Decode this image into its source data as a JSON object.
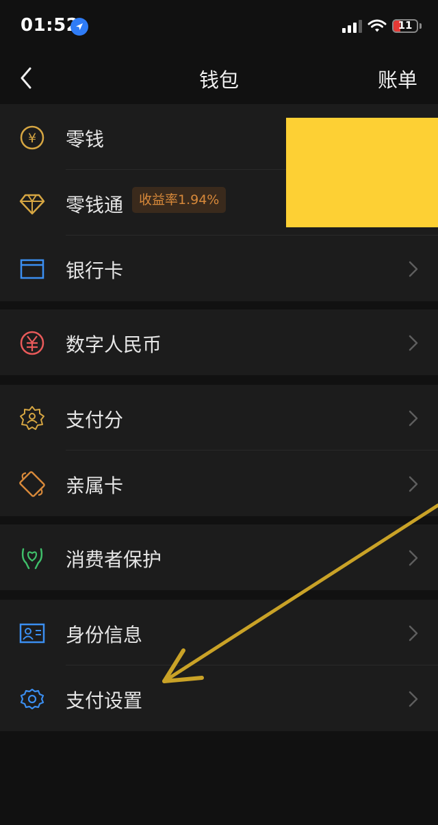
{
  "status_bar": {
    "time": "01:52",
    "battery": "11",
    "icons": [
      "location-arrow-icon",
      "cellular-signal-icon",
      "wifi-icon",
      "battery-icon"
    ]
  },
  "nav": {
    "title": "钱包",
    "right_label": "账单",
    "back_icon": "chevron-left-icon"
  },
  "groups": [
    {
      "items": [
        {
          "label": "零钱",
          "icon": "yuan-coin-icon",
          "color": "#d6a642"
        },
        {
          "label": "零钱通",
          "icon": "diamond-icon",
          "color": "#d6a642",
          "badge": "收益率1.94%"
        },
        {
          "label": "银行卡",
          "icon": "bank-card-icon",
          "color": "#3b8ff2"
        }
      ]
    },
    {
      "items": [
        {
          "label": "数字人民币",
          "icon": "digital-rmb-icon",
          "color": "#e95a5a"
        }
      ]
    },
    {
      "items": [
        {
          "label": "支付分",
          "icon": "pay-score-icon",
          "color": "#d6a642"
        },
        {
          "label": "亲属卡",
          "icon": "family-card-icon",
          "color": "#d8893a"
        }
      ]
    },
    {
      "items": [
        {
          "label": "消费者保护",
          "icon": "consumer-protection-icon",
          "color": "#3fbf6a"
        }
      ]
    },
    {
      "items": [
        {
          "label": "身份信息",
          "icon": "id-card-icon",
          "color": "#3b8ff2"
        },
        {
          "label": "支付设置",
          "icon": "gear-icon",
          "color": "#3b8ff2"
        }
      ]
    }
  ],
  "colors": {
    "background": "#111111",
    "card": "#1c1c1c",
    "redaction": "#fdd034",
    "arrow": "#c9a227"
  }
}
